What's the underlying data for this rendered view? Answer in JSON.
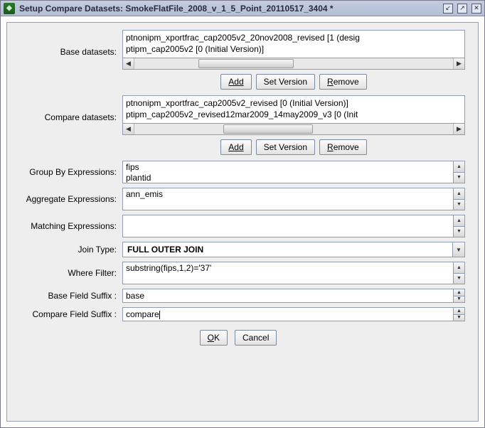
{
  "titlebar": {
    "title": "Setup Compare Datasets: SmokeFlatFile_2008_v_1_5_Point_20110517_3404 *"
  },
  "window_controls": {
    "min": "↙",
    "max": "↗",
    "close": "✕"
  },
  "labels": {
    "base_datasets": "Base datasets:",
    "compare_datasets": "Compare datasets:",
    "group_by": "Group By Expressions:",
    "aggregate": "Aggregate Expressions:",
    "matching": "Matching Expressions:",
    "join_type": "Join Type:",
    "where_filter": "Where Filter:",
    "base_suffix": "Base Field Suffix :",
    "compare_suffix": "Compare Field Suffix :"
  },
  "base_datasets": {
    "items": [
      "ptnonipm_xportfrac_cap2005v2_20nov2008_revised [1 (desig",
      "ptipm_cap2005v2 [0 (Initial Version)]"
    ]
  },
  "base_datasets_buttons": {
    "add": "Add",
    "set_version": "Set Version",
    "remove": "Remove"
  },
  "compare_datasets": {
    "items": [
      "ptnonipm_xportfrac_cap2005v2_revised [0 (Initial Version)]",
      "ptipm_cap2005v2_revised12mar2009_14may2009_v3 [0 (Init"
    ]
  },
  "compare_datasets_buttons": {
    "add": "Add",
    "set_version": "Set Version",
    "remove": "Remove"
  },
  "group_by": {
    "line1": "fips",
    "line2": "plantid"
  },
  "aggregate": {
    "value": "ann_emis"
  },
  "matching": {
    "value": ""
  },
  "join_type": {
    "value": "FULL OUTER JOIN"
  },
  "where_filter": {
    "value": "substring(fips,1,2)='37'"
  },
  "base_suffix": {
    "value": "base"
  },
  "compare_suffix": {
    "value": "compare"
  },
  "bottom_buttons": {
    "ok": "OK",
    "cancel": "Cancel"
  }
}
